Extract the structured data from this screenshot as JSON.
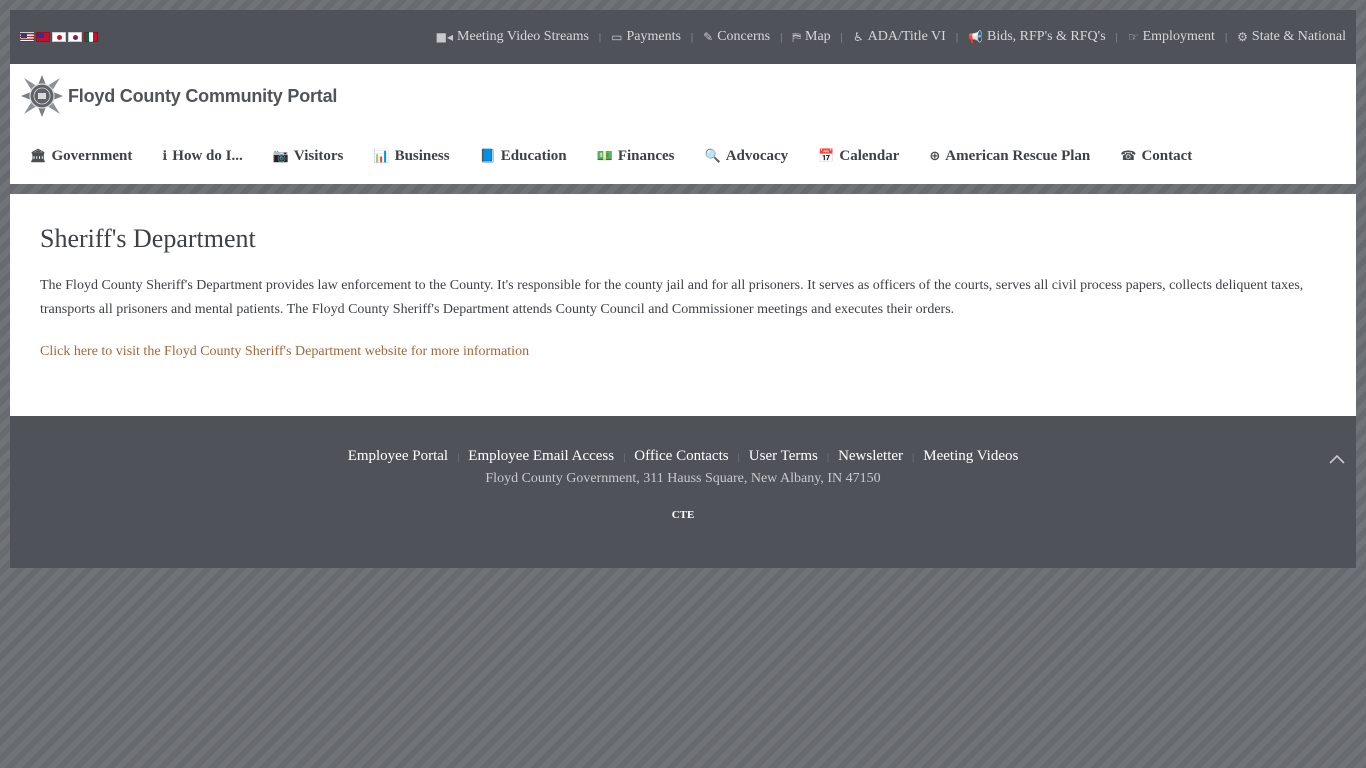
{
  "topbar": {
    "flags": [
      "us-flag",
      "tw-flag",
      "jp-flag",
      "kr-flag",
      "mx-flag"
    ],
    "links": [
      {
        "label": "Meeting Video Streams",
        "icon": "video-camera-icon"
      },
      {
        "label": "Payments",
        "icon": "credit-card-icon"
      },
      {
        "label": "Concerns",
        "icon": "edit-icon"
      },
      {
        "label": "Map",
        "icon": "map-icon"
      },
      {
        "label": "ADA/Title VI",
        "icon": "wheelchair-icon"
      },
      {
        "label": "Bids, RFP's & RFQ's",
        "icon": "bullhorn-icon"
      },
      {
        "label": "Employment",
        "icon": "hand-pointer-icon"
      },
      {
        "label": "State & National",
        "icon": "gears-icon"
      }
    ]
  },
  "header": {
    "site_title": "Floyd County Community Portal"
  },
  "mainnav": {
    "items": [
      {
        "label": "Government",
        "icon": "bank-icon"
      },
      {
        "label": "How do I...",
        "icon": "info-circle-icon"
      },
      {
        "label": "Visitors",
        "icon": "camera-icon"
      },
      {
        "label": "Business",
        "icon": "bar-chart-icon"
      },
      {
        "label": "Education",
        "icon": "book-icon"
      },
      {
        "label": "Finances",
        "icon": "money-icon"
      },
      {
        "label": "Advocacy",
        "icon": "search-plus-icon"
      },
      {
        "label": "Calendar",
        "icon": "calendar-icon"
      },
      {
        "label": "American Rescue Plan",
        "icon": "life-ring-icon"
      },
      {
        "label": "Contact",
        "icon": "phone-icon"
      }
    ]
  },
  "main": {
    "title": "Sheriff's Department",
    "body": "The Floyd County Sheriff's Department provides law enforcement to the County. It's responsible for the county jail and for all prisoners. It serves as officers of the courts, serves all civil process papers, collects deliquent taxes, transports all prisoners and mental patients. The Floyd County Sheriff's Department attends County Council and Commissioner meetings and executes their orders.",
    "link_text": "Click here to visit the Floyd County Sheriff's Department website for more information"
  },
  "footer": {
    "links": [
      "Employee Portal",
      "Employee Email Access",
      "Office Contacts",
      "User Terms",
      "Newsletter",
      "Meeting Videos"
    ],
    "address": "Floyd County Government, 311 Hauss Square, New Albany, IN 47150",
    "credit": "CTE"
  },
  "colors": {
    "bar_bg": "#4f5258",
    "page_bg": "#6b6e73",
    "link_accent": "#a3673a",
    "text": "#3e4146"
  }
}
